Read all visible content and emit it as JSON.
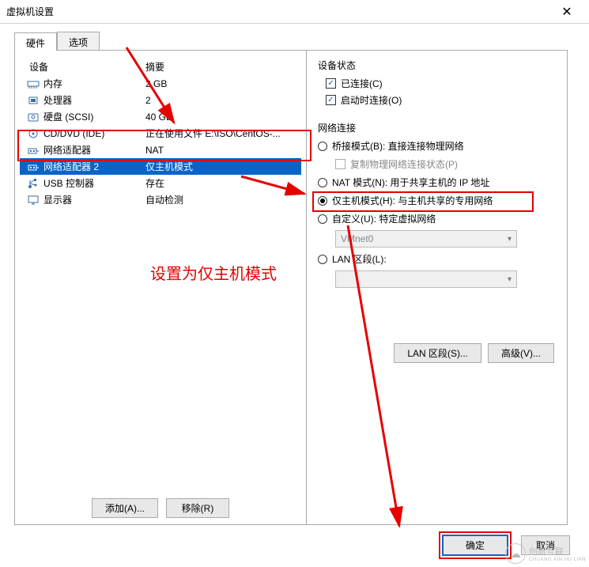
{
  "window": {
    "title": "虚拟机设置",
    "close": "✕"
  },
  "tabs": {
    "hardware": "硬件",
    "options": "选项"
  },
  "hw_header": {
    "device": "设备",
    "summary": "摘要"
  },
  "hardware": [
    {
      "name": "内存",
      "summary": "2 GB",
      "icon": "memory"
    },
    {
      "name": "处理器",
      "summary": "2",
      "icon": "cpu"
    },
    {
      "name": "硬盘 (SCSI)",
      "summary": "40 GB",
      "icon": "disk"
    },
    {
      "name": "CD/DVD (IDE)",
      "summary": "正在使用文件 E:\\ISO\\CentOS-...",
      "icon": "cd"
    },
    {
      "name": "网络适配器",
      "summary": "NAT",
      "icon": "net"
    },
    {
      "name": "网络适配器 2",
      "summary": "仅主机模式",
      "icon": "net",
      "selected": true
    },
    {
      "name": "USB 控制器",
      "summary": "存在",
      "icon": "usb"
    },
    {
      "name": "显示器",
      "summary": "自动检测",
      "icon": "display"
    }
  ],
  "left_btns": {
    "add": "添加(A)...",
    "remove": "移除(R)"
  },
  "status": {
    "legend": "设备状态",
    "connected": "已连接(C)",
    "connect_on_start": "启动时连接(O)"
  },
  "net": {
    "legend": "网络连接",
    "bridged": "桥接模式(B): 直接连接物理网络",
    "replicate": "复制物理网络连接状态(P)",
    "nat": "NAT 模式(N): 用于共享主机的 IP 地址",
    "hostonly": "仅主机模式(H): 与主机共享的专用网络",
    "custom": "自定义(U): 特定虚拟网络",
    "vmnet": "VMnet0",
    "lanseg": "LAN 区段(L):"
  },
  "right_btns": {
    "lan": "LAN 区段(S)...",
    "adv": "高级(V)..."
  },
  "annotation": "设置为仅主机模式",
  "footer": {
    "ok": "确定",
    "cancel": "取消"
  },
  "watermark": {
    "text": "创新互联",
    "sub": "CHUANG XIN HU LIAN",
    "logo": "☁"
  }
}
